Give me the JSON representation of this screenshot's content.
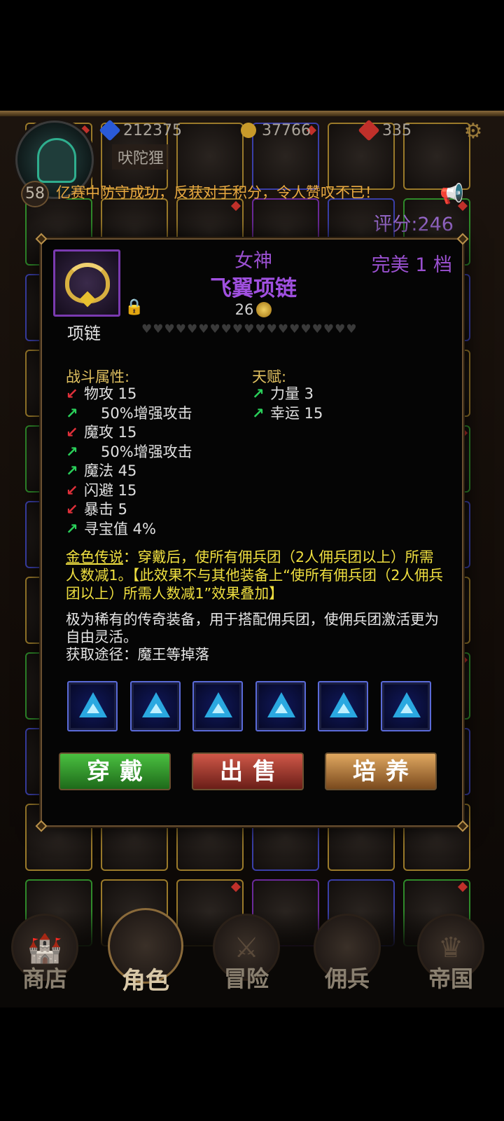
{
  "header": {
    "level": "58",
    "player_name": "吠陀狸",
    "resources": [
      {
        "icon": "blue-gem-icon",
        "value": "212375",
        "color": "#2a5ad8"
      },
      {
        "icon": "gold-coin-icon",
        "value": "37766",
        "color": "#c89a2a"
      },
      {
        "icon": "red-gem-icon",
        "value": "335",
        "color": "#c0302a"
      }
    ],
    "ticker": "亿赛中防守成功，反获对手积分，令人赞叹不已！",
    "score": "评分:246"
  },
  "item": {
    "prefix": "女神",
    "name": "飞翼项链",
    "rank": "完美 1 档",
    "level": "26",
    "type": "项链",
    "hearts": "♥♥♥♥♥♥♥♥♥♥♥♥♥♥♥♥♥♥♥",
    "combat_title": "战斗属性:",
    "combat_stats": [
      {
        "dir": "down",
        "text": "物攻 15",
        "indent": false
      },
      {
        "dir": "up",
        "text": "50%增强攻击",
        "indent": true
      },
      {
        "dir": "down",
        "text": "魔攻 15",
        "indent": false
      },
      {
        "dir": "up",
        "text": "50%增强攻击",
        "indent": true
      },
      {
        "dir": "up",
        "text": "魔法 45",
        "indent": false
      },
      {
        "dir": "down",
        "text": "闪避 15",
        "indent": false
      },
      {
        "dir": "down",
        "text": "暴击 5",
        "indent": false
      },
      {
        "dir": "up",
        "text": "寻宝值 4%",
        "indent": false
      }
    ],
    "talent_title": "天赋:",
    "talent_stats": [
      {
        "dir": "up",
        "text": "力量 3"
      },
      {
        "dir": "up",
        "text": "幸运 15"
      }
    ],
    "legend_key": "金色传说",
    "legend_text": "：穿戴后，使所有佣兵团（2人佣兵团以上）所需人数减1。【此效果不与其他装备上“使所有佣兵团（2人佣兵团以上）所需人数减1”效果叠加】",
    "description": "极为稀有的传奇装备，用于搭配佣兵团，使佣兵团激活更为自由灵活。",
    "source": "获取途径：魔王等掉落",
    "sockets": 6
  },
  "actions": {
    "wear": "穿戴",
    "sell": "出售",
    "train": "培养"
  },
  "nav": [
    {
      "label": "商店",
      "icon": "shop-icon"
    },
    {
      "label": "角色",
      "icon": "character-icon"
    },
    {
      "label": "冒险",
      "icon": "adventure-icon"
    },
    {
      "label": "佣兵",
      "icon": "mercenary-icon"
    },
    {
      "label": "帝国",
      "icon": "empire-icon"
    }
  ]
}
